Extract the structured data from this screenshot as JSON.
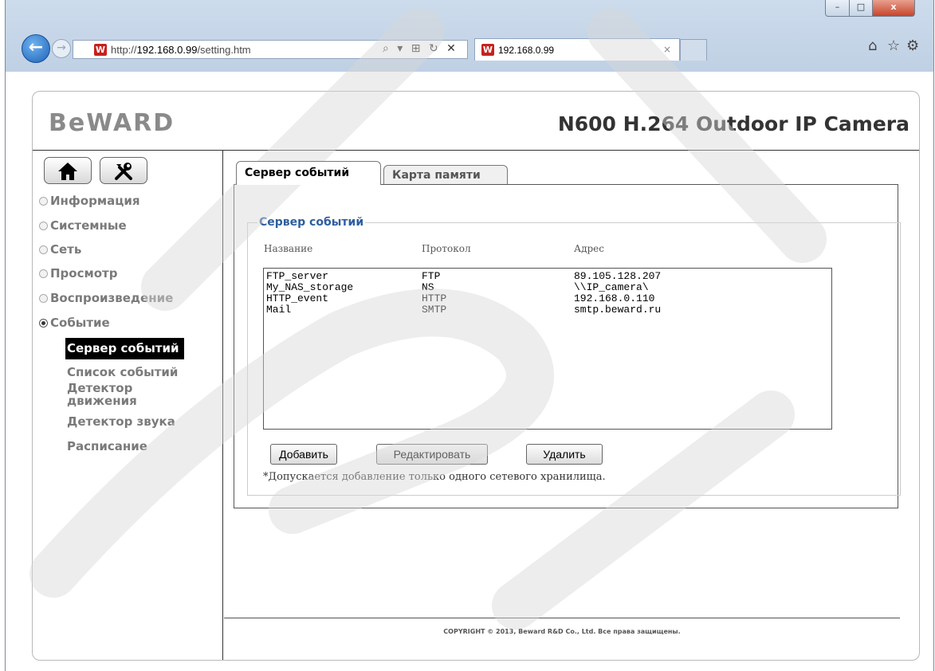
{
  "browser": {
    "window_controls": {
      "minimize": "–",
      "maximize": "□",
      "close": "x"
    },
    "back_icon": "←",
    "forward_icon": "→",
    "url_prefix": "http://",
    "url_host": "192.168.0.99",
    "url_path": "/setting.htm",
    "address_tools": "⌕ ▾ ⊞ ↻ ✕",
    "tab_title": "192.168.0.99",
    "tab_close": "×",
    "favicon": "W",
    "home_icon": "⌂",
    "star_icon": "☆",
    "gear_icon": "⚙"
  },
  "header": {
    "logo": "BeWARD",
    "title": "N600 H.264 Outdoor IP Camera"
  },
  "sidebar": {
    "items": [
      {
        "label": "Информация",
        "selected": false
      },
      {
        "label": "Системные",
        "selected": false
      },
      {
        "label": "Сеть",
        "selected": false
      },
      {
        "label": "Просмотр",
        "selected": false
      },
      {
        "label": "Воспроизведение",
        "selected": false
      },
      {
        "label": "Событие",
        "selected": true
      }
    ],
    "subitems": [
      {
        "label": "Сервер событий",
        "active": true
      },
      {
        "label": "Список событий",
        "active": false
      },
      {
        "label": "Детектор движения",
        "active": false
      },
      {
        "label": "Детектор звука",
        "active": false
      },
      {
        "label": "Расписание",
        "active": false
      }
    ]
  },
  "tabs": [
    {
      "label": "Сервер событий",
      "active": true
    },
    {
      "label": "Карта памяти",
      "active": false
    }
  ],
  "event_servers": {
    "legend": "Сервер событий",
    "columns": [
      "Название",
      "Протокол",
      "Адрес"
    ],
    "rows": [
      {
        "name": "FTP_server",
        "protocol": "FTP",
        "address": "89.105.128.207"
      },
      {
        "name": "My_NAS_storage",
        "protocol": "NS",
        "address": "\\\\IP_camera\\"
      },
      {
        "name": "HTTP_event",
        "protocol": "HTTP",
        "address": "192.168.0.110"
      },
      {
        "name": "Mail",
        "protocol": "SMTP",
        "address": "smtp.beward.ru"
      }
    ],
    "buttons": {
      "add": "Добавить",
      "edit": "Редактировать",
      "delete": "Удалить"
    },
    "note": "*Допускается добавление только одного сетевого хранилища."
  },
  "footer": {
    "copyright": "COPYRIGHT © 2013, Beward R&D Co., Ltd. Все права защищены."
  },
  "colors": {
    "accent": "#2e5e9e",
    "active_item_bg": "#000000",
    "favicon": "#c6211d"
  }
}
